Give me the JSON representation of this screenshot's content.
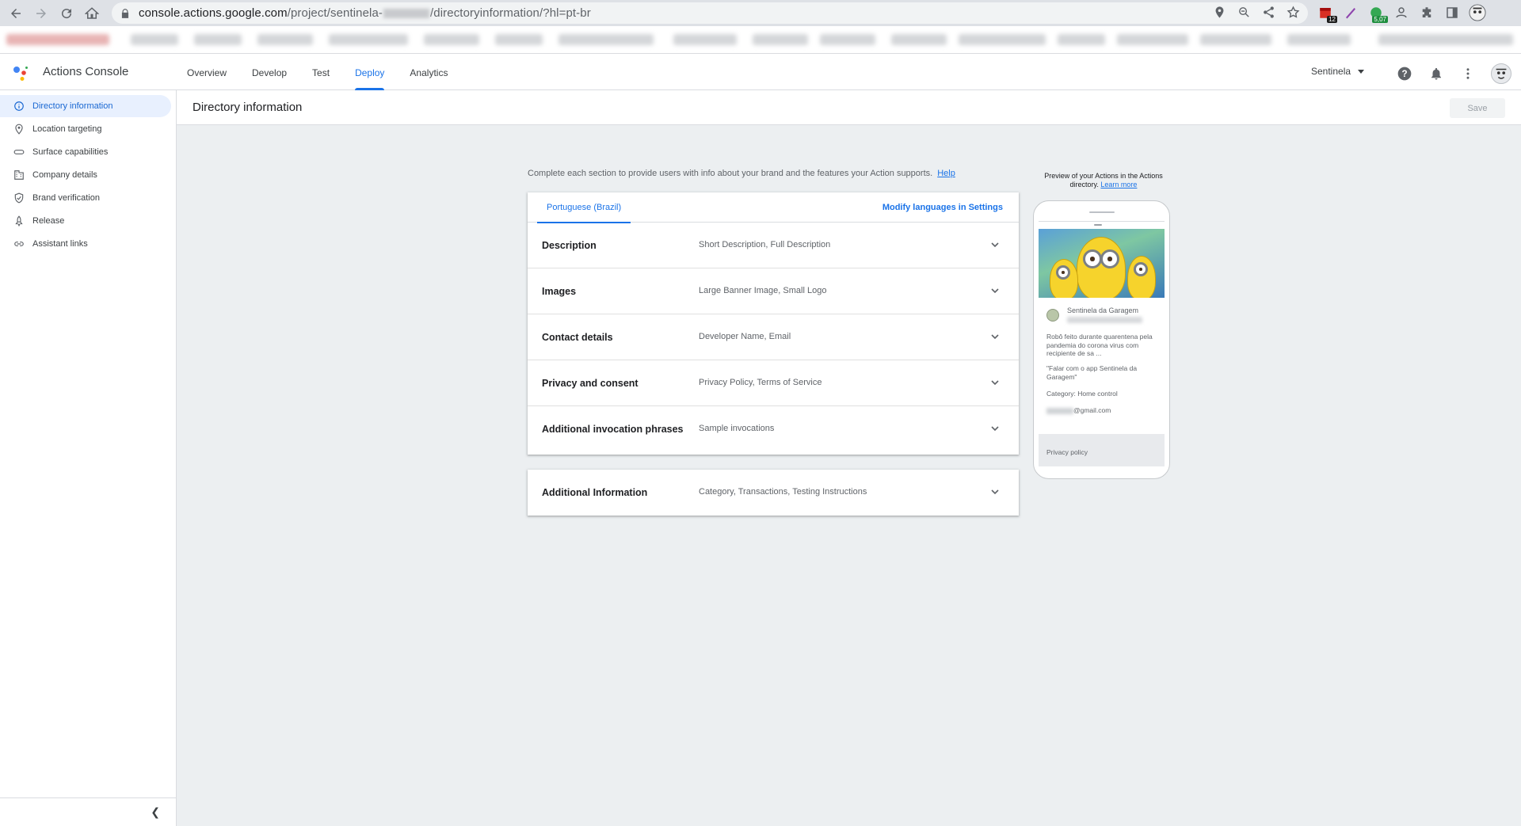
{
  "browser": {
    "url_host": "console.actions.google.com",
    "url_path_before": "/project/sentinela-",
    "url_path_after": "/directoryinformation/?hl=pt-br",
    "extension_badge_1": "12",
    "extension_badge_2": "5,07"
  },
  "app": {
    "title": "Actions Console",
    "tabs": [
      {
        "label": "Overview"
      },
      {
        "label": "Develop"
      },
      {
        "label": "Test"
      },
      {
        "label": "Deploy",
        "active": true
      },
      {
        "label": "Analytics"
      }
    ],
    "project_name": "Sentinela"
  },
  "sidebar": {
    "items": [
      {
        "label": "Directory information",
        "icon": "info-icon",
        "active": true
      },
      {
        "label": "Location targeting",
        "icon": "location-pin-icon"
      },
      {
        "label": "Surface capabilities",
        "icon": "link-chain-icon"
      },
      {
        "label": "Company details",
        "icon": "building-icon"
      },
      {
        "label": "Brand verification",
        "icon": "shield-check-icon"
      },
      {
        "label": "Release",
        "icon": "rocket-icon"
      },
      {
        "label": "Assistant links",
        "icon": "link-icon"
      }
    ]
  },
  "page": {
    "title": "Directory information",
    "save_label": "Save",
    "intro_text": "Complete each section to provide users with info about your brand and the features your Action supports.",
    "help_link": "Help"
  },
  "languages": {
    "active_tab": "Portuguese (Brazil)",
    "modify_link": "Modify languages in Settings"
  },
  "sections": [
    {
      "title": "Description",
      "summary": "Short Description, Full Description"
    },
    {
      "title": "Images",
      "summary": "Large Banner Image, Small Logo"
    },
    {
      "title": "Contact details",
      "summary": "Developer Name, Email"
    },
    {
      "title": "Privacy and consent",
      "summary": "Privacy Policy, Terms of Service"
    },
    {
      "title": "Additional invocation phrases",
      "summary": "Sample invocations"
    }
  ],
  "extra_section": {
    "title": "Additional Information",
    "summary": "Category, Transactions, Testing Instructions"
  },
  "preview": {
    "label": "Preview of your Actions in the Actions directory.",
    "learn_more": "Learn more",
    "app_name": "Sentinela da Garagem",
    "description": "Robô feito durante quarentena pela pandemia do corona virus com recipiente de sa ...",
    "invocation": "\"Falar com o app Sentinela da Garagem\"",
    "category": "Category: Home control",
    "email_suffix": "@gmail.com",
    "privacy": "Privacy policy"
  },
  "colors": {
    "accent": "#1a73e8",
    "page_bg": "#eceff1",
    "sidebar_active_bg": "#e8f0fe"
  }
}
